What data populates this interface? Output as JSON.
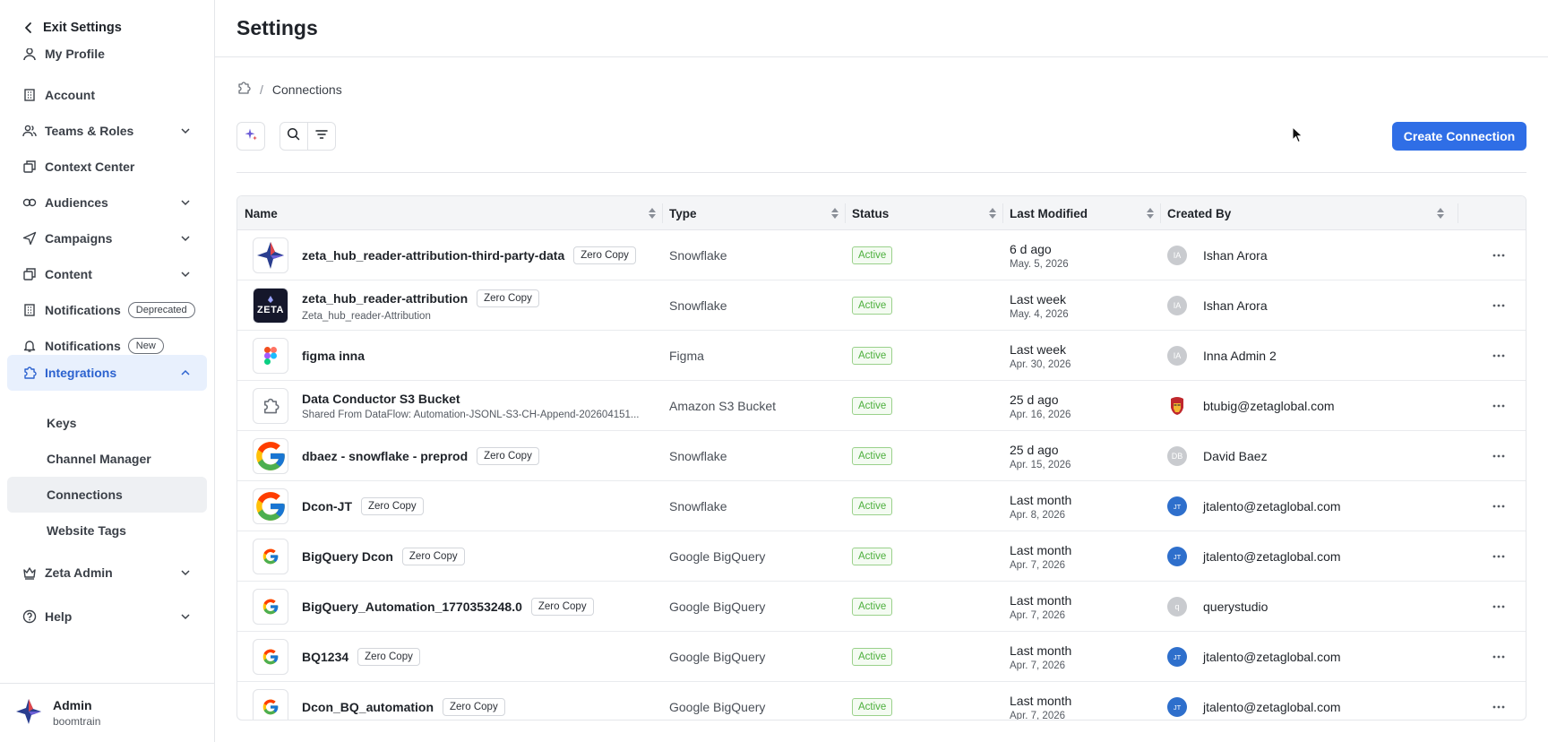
{
  "sidebar": {
    "exit_label": "Exit Settings",
    "partial_item": "My Profile",
    "items": [
      {
        "label": "Account"
      },
      {
        "label": "Teams & Roles"
      },
      {
        "label": "Context Center"
      },
      {
        "label": "Audiences"
      },
      {
        "label": "Campaigns"
      },
      {
        "label": "Content"
      },
      {
        "label": "Notifications",
        "badge": "Deprecated"
      },
      {
        "label": "Notifications",
        "badge": "New"
      },
      {
        "label": "Integrations"
      },
      {
        "label": "Zeta Admin"
      },
      {
        "label": "Help"
      }
    ],
    "sub_items": [
      {
        "label": "Keys"
      },
      {
        "label": "Channel Manager"
      },
      {
        "label": "Connections"
      },
      {
        "label": "Website Tags"
      }
    ],
    "profile": {
      "name": "Admin",
      "org": "boomtrain"
    }
  },
  "header": {
    "title": "Settings"
  },
  "breadcrumb": {
    "current": "Connections",
    "separator": "/"
  },
  "toolbar": {
    "create_label": "Create Connection"
  },
  "table": {
    "columns": [
      "Name",
      "Type",
      "Status",
      "Last Modified",
      "Created By"
    ],
    "rows": [
      {
        "name": "zeta_hub_reader-attribution-third-party-data",
        "tag": "Zero Copy",
        "sub": "",
        "logo": "zeta-diamond-logo",
        "type": "Snowflake",
        "status": "Active",
        "rel": "6 d ago",
        "date": "May. 5, 2026",
        "creator": "Ishan Arora",
        "initials": "IA",
        "avatar": "grey"
      },
      {
        "name": "zeta_hub_reader-attribution",
        "tag": "Zero Copy",
        "sub": "Zeta_hub_reader-Attribution",
        "logo": "zeta-dark-logo",
        "type": "Snowflake",
        "status": "Active",
        "rel": "Last week",
        "date": "May. 4, 2026",
        "creator": "Ishan Arora",
        "initials": "IA",
        "avatar": "grey"
      },
      {
        "name": "figma inna",
        "tag": "",
        "sub": "",
        "logo": "figma-logo",
        "type": "Figma",
        "status": "Active",
        "rel": "Last week",
        "date": "Apr. 30, 2026",
        "creator": "Inna Admin 2",
        "initials": "IA",
        "avatar": "grey"
      },
      {
        "name": "Data Conductor S3 Bucket",
        "tag": "",
        "sub": "Shared From DataFlow: Automation-JSONL-S3-CH-Append-202604151...",
        "logo": "puzzle-logo",
        "type": "Amazon S3 Bucket",
        "status": "Active",
        "rel": "25 d ago",
        "date": "Apr. 16, 2026",
        "creator": "btubig@zetaglobal.com",
        "initials": "",
        "avatar": "iron"
      },
      {
        "name": "dbaez - snowflake - preprod",
        "tag": "Zero Copy",
        "sub": "",
        "logo": "google-logo-large",
        "type": "Snowflake",
        "status": "Active",
        "rel": "25 d ago",
        "date": "Apr. 15, 2026",
        "creator": "David Baez",
        "initials": "DB",
        "avatar": "grey"
      },
      {
        "name": "Dcon-JT",
        "tag": "Zero Copy",
        "sub": "",
        "logo": "google-logo-large",
        "type": "Snowflake",
        "status": "Active",
        "rel": "Last month",
        "date": "Apr. 8, 2026",
        "creator": "jtalento@zetaglobal.com",
        "initials": "JT",
        "avatar": "blue"
      },
      {
        "name": "BigQuery Dcon",
        "tag": "Zero Copy",
        "sub": "",
        "logo": "google-logo",
        "type": "Google BigQuery",
        "status": "Active",
        "rel": "Last month",
        "date": "Apr. 7, 2026",
        "creator": "jtalento@zetaglobal.com",
        "initials": "JT",
        "avatar": "blue"
      },
      {
        "name": "BigQuery_Automation_1770353248.0",
        "tag": "Zero Copy",
        "sub": "",
        "logo": "google-logo",
        "type": "Google BigQuery",
        "status": "Active",
        "rel": "Last month",
        "date": "Apr. 7, 2026",
        "creator": "querystudio",
        "initials": "q",
        "avatar": "grey"
      },
      {
        "name": "BQ1234",
        "tag": "Zero Copy",
        "sub": "",
        "logo": "google-logo",
        "type": "Google BigQuery",
        "status": "Active",
        "rel": "Last month",
        "date": "Apr. 7, 2026",
        "creator": "jtalento@zetaglobal.com",
        "initials": "JT",
        "avatar": "blue"
      },
      {
        "name": "Dcon_BQ_automation",
        "tag": "Zero Copy",
        "sub": "",
        "logo": "google-logo",
        "type": "Google BigQuery",
        "status": "Active",
        "rel": "Last month",
        "date": "Apr. 7, 2026",
        "creator": "jtalento@zetaglobal.com",
        "initials": "JT",
        "avatar": "blue"
      }
    ]
  },
  "colors": {
    "accent": "#2f6ee6",
    "active_nav_bg": "#e8f0fd",
    "active_nav_text": "#2c62cf",
    "status_green": "#4caf3c"
  }
}
